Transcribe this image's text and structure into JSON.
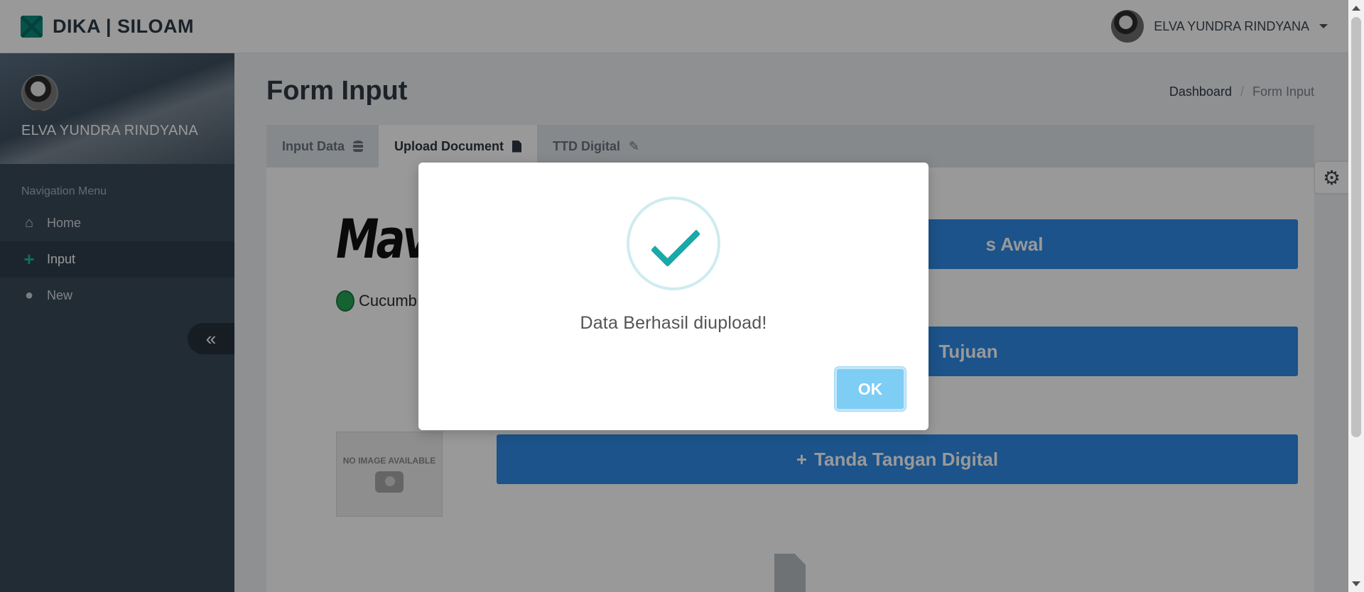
{
  "header": {
    "brand": "DIKA | SILOAM",
    "user_name": "ELVA YUNDRA RINDYANA"
  },
  "sidebar": {
    "profile_name": "ELVA YUNDRA RINDYANA",
    "nav_header": "Navigation Menu",
    "items": [
      {
        "label": "Home",
        "icon": "home-icon",
        "active": false
      },
      {
        "label": "Input",
        "icon": "plus-icon",
        "active": true
      },
      {
        "label": "New",
        "icon": "user-icon",
        "active": false
      }
    ],
    "collapse_glyph": "«"
  },
  "page": {
    "title": "Form Input",
    "breadcrumb": [
      "Dashboard",
      "Form Input"
    ]
  },
  "tabs": [
    {
      "label": "Input Data",
      "icon": "database-icon",
      "active": false
    },
    {
      "label": "Upload Document",
      "icon": "file-icon",
      "active": true
    },
    {
      "label": "TTD Digital",
      "icon": "pencil-icon",
      "active": false
    }
  ],
  "rows": [
    {
      "image_text": "Maven",
      "button_label": "s Awal"
    },
    {
      "image_text": "Cucumb",
      "button_label": "Tujuan"
    },
    {
      "image_text": "NO IMAGE AVAILABLE",
      "button_label": "Tanda Tangan Digital",
      "button_icon": "+"
    }
  ],
  "modal": {
    "message": "Data Berhasil diupload!",
    "ok_label": "OK",
    "icon": "success-check-icon"
  },
  "colors": {
    "primary_button": "#2e8ae6",
    "accent": "#19b7a6",
    "ok_button": "#7dcdf5"
  }
}
